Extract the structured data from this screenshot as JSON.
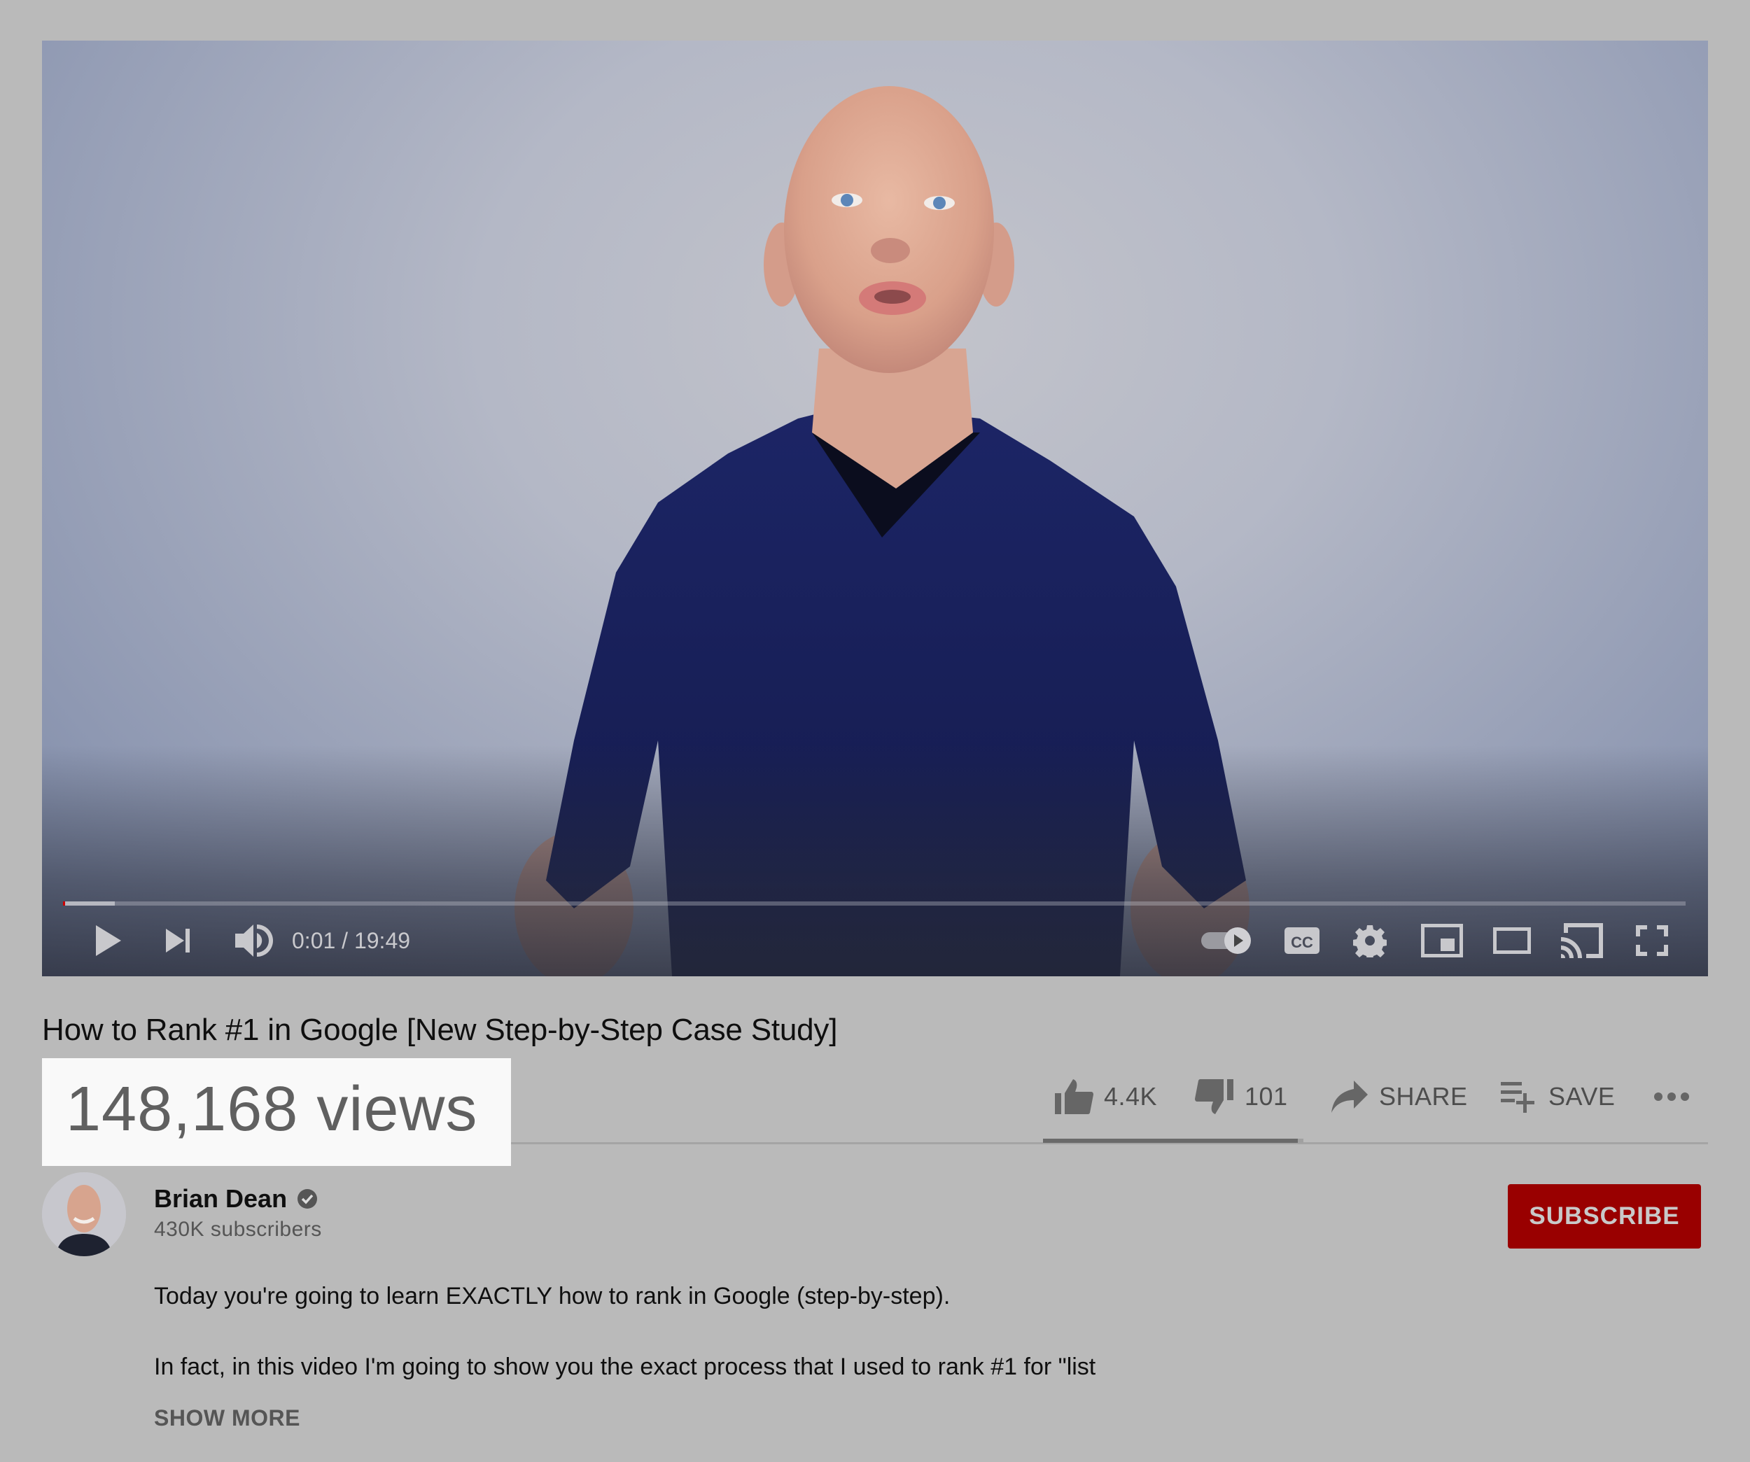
{
  "player": {
    "time_current": "0:01",
    "time_total": "19:49",
    "time_display": "0:01 / 19:49",
    "progress_played_fraction": 0.0008,
    "progress_buffered_fraction": 0.032,
    "autoplay_on": true,
    "controls": [
      {
        "name": "play",
        "icon": "play-icon"
      },
      {
        "name": "next",
        "icon": "skip-next-icon"
      },
      {
        "name": "volume",
        "icon": "volume-icon"
      },
      {
        "name": "autoplay",
        "icon": "autoplay-toggle-icon"
      },
      {
        "name": "captions",
        "icon": "cc-icon",
        "label": "CC"
      },
      {
        "name": "settings",
        "icon": "gear-icon"
      },
      {
        "name": "miniplayer",
        "icon": "miniplayer-icon"
      },
      {
        "name": "theater",
        "icon": "theater-mode-icon"
      },
      {
        "name": "cast",
        "icon": "cast-icon"
      },
      {
        "name": "fullscreen",
        "icon": "fullscreen-icon"
      }
    ]
  },
  "video": {
    "title": "How to Rank #1 in Google [New Step-by-Step Case Study]",
    "views": "148,168 views"
  },
  "actions": {
    "like_count": "4.4K",
    "dislike_count": "101",
    "share_label": "SHARE",
    "save_label": "SAVE",
    "more_icon": "more-horizontal-icon",
    "like_ratio": 0.978
  },
  "channel": {
    "name": "Brian Dean",
    "verified": true,
    "subscribers": "430K subscribers",
    "subscribe_label": "SUBSCRIBE"
  },
  "colors": {
    "subscribe_bg": "#990000",
    "page_bg": "#bababa",
    "views_highlight_bg": "#f9f9f9",
    "progress_played": "#cc0000"
  },
  "description": {
    "lines": [
      "Today you're going to learn EXACTLY how to rank in Google (step-by-step).",
      "In fact, in this video I'm going to show you the exact process that I used to rank #1 for \"list"
    ],
    "show_more_label": "SHOW MORE"
  }
}
